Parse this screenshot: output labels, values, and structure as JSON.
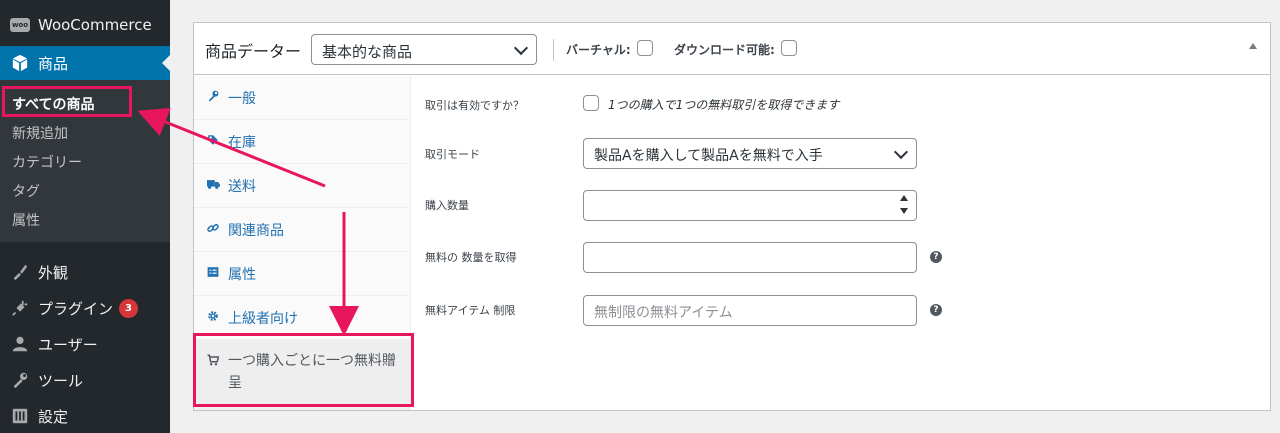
{
  "sidebar": {
    "woocommerce": "WooCommerce",
    "woo_logo_text": "woo",
    "products": "商品",
    "submenu": [
      "すべての商品",
      "新規追加",
      "カテゴリー",
      "タグ",
      "属性"
    ],
    "menu": [
      {
        "label": "外観",
        "icon": "paintbrush-icon"
      },
      {
        "label": "プラグイン",
        "icon": "plugin-icon",
        "badge": "3"
      },
      {
        "label": "ユーザー",
        "icon": "user-icon"
      },
      {
        "label": "ツール",
        "icon": "wrench-icon"
      },
      {
        "label": "設定",
        "icon": "settings-icon"
      }
    ]
  },
  "product_data": {
    "title": "商品データー",
    "type_value": "基本的な商品",
    "virtual_label": "バーチャル:",
    "downloadable_label": "ダウンロード可能:"
  },
  "tabs": [
    {
      "label": "一般",
      "icon": "wrench-icon"
    },
    {
      "label": "在庫",
      "icon": "tag-icon"
    },
    {
      "label": "送料",
      "icon": "truck-icon"
    },
    {
      "label": "関連商品",
      "icon": "link-icon"
    },
    {
      "label": "属性",
      "icon": "list-icon"
    },
    {
      "label": "上級者向け",
      "icon": "gear-icon"
    },
    {
      "label": "一つ購入ごとに一つ無料贈呈",
      "icon": "cart-icon"
    }
  ],
  "fields": {
    "enabled_label": "取引は有効ですか？",
    "enabled_desc": "1つの購入で1つの無料取引を取得できます",
    "mode_label": "取引モード",
    "mode_value": "製品Aを購入して製品Aを無料で入手",
    "qty_label": "購入数量",
    "qty_value": "",
    "free_qty_label": "無料の 数量を取得",
    "free_qty_value": "",
    "limit_label": "無料アイテム 制限",
    "limit_placeholder": "無制限の無料アイテム",
    "help_glyph": "?"
  },
  "colors": {
    "sidebar_bg": "#23282d",
    "active_menu": "#0073aa",
    "highlight": "#e8175d",
    "link": "#2271b1"
  }
}
